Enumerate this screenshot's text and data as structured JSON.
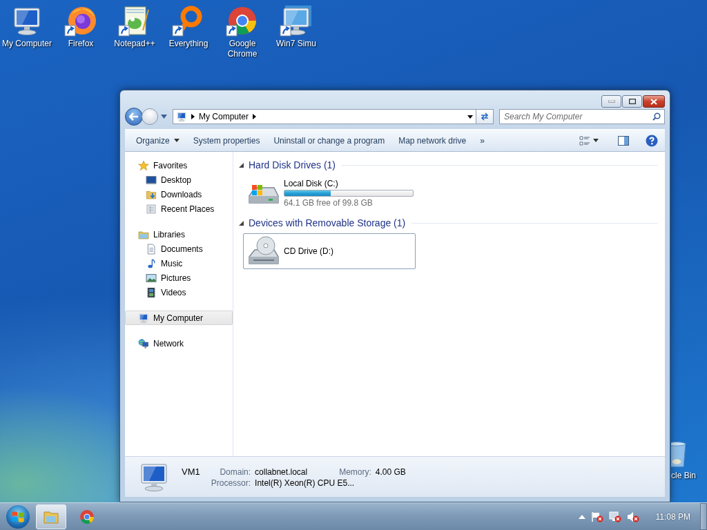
{
  "desktop_icons": [
    {
      "label": "My Computer",
      "kind": "computer",
      "shortcut": false
    },
    {
      "label": "Firefox",
      "kind": "firefox",
      "shortcut": true
    },
    {
      "label": "Notepad++",
      "kind": "notepad",
      "shortcut": true
    },
    {
      "label": "Everything",
      "kind": "everything",
      "shortcut": true
    },
    {
      "label": "Google Chrome",
      "kind": "chrome",
      "shortcut": true
    },
    {
      "label": "Win7 Simu",
      "kind": "simu",
      "shortcut": true
    }
  ],
  "recycle_bin": {
    "label": "cle Bin"
  },
  "window": {
    "address": {
      "path": "My Computer"
    },
    "search": {
      "placeholder": "Search My Computer"
    },
    "toolbar": [
      {
        "label": "Organize",
        "dropdown": true
      },
      {
        "label": "System properties",
        "dropdown": false
      },
      {
        "label": "Uninstall or change a program",
        "dropdown": false
      },
      {
        "label": "Map network drive",
        "dropdown": false
      },
      {
        "label": "»",
        "dropdown": false
      }
    ],
    "sidebar": [
      {
        "label": "Favorites",
        "kind": "star",
        "selected": false,
        "children": [
          {
            "label": "Desktop",
            "kind": "desktop",
            "selected": false
          },
          {
            "label": "Downloads",
            "kind": "downloads",
            "selected": false
          },
          {
            "label": "Recent Places",
            "kind": "recent",
            "selected": false
          }
        ]
      },
      {
        "label": "Libraries",
        "kind": "libraries",
        "selected": false,
        "children": [
          {
            "label": "Documents",
            "kind": "documents",
            "selected": false
          },
          {
            "label": "Music",
            "kind": "music",
            "selected": false
          },
          {
            "label": "Pictures",
            "kind": "pictures",
            "selected": false
          },
          {
            "label": "Videos",
            "kind": "videos",
            "selected": false
          }
        ]
      },
      {
        "label": "My Computer",
        "kind": "computer",
        "selected": true
      },
      {
        "label": "Network",
        "kind": "network",
        "selected": false
      }
    ],
    "sections": [
      {
        "title": "Hard Disk Drives (1)",
        "expanded": true,
        "items": [
          {
            "name": "Local Disk (C:)",
            "kind": "disk",
            "selected": false,
            "level": 0.36,
            "reading": "64.1 GB free of 99.8 GB"
          }
        ]
      },
      {
        "title": "Devices with Removable Storage (1)",
        "expanded": true,
        "items": [
          {
            "name": "CD Drive (D:)",
            "kind": "cd",
            "selected": true
          }
        ]
      }
    ],
    "details": {
      "name": "VM1",
      "fields": [
        {
          "label": "Domain:",
          "value": "collabnet.local"
        },
        {
          "label": "Memory:",
          "value": "4.00 GB"
        },
        {
          "label": "Processor:",
          "value": "Intel(R) Xeon(R) CPU E5..."
        }
      ]
    }
  },
  "taskbar": {
    "buttons": [
      {
        "kind": "explorer",
        "selected": true
      },
      {
        "kind": "chrome",
        "selected": false
      }
    ],
    "clock": "11:08 PM"
  }
}
